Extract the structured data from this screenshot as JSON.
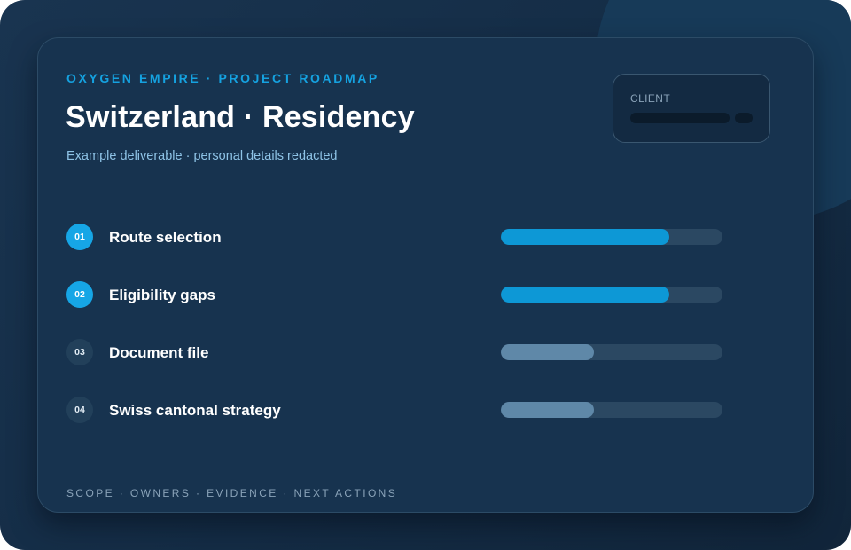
{
  "header": {
    "kicker": "OXYGEN EMPIRE · PROJECT ROADMAP",
    "title": "Switzerland · Residency",
    "subtitle": "Example deliverable · personal details redacted"
  },
  "client": {
    "label": "CLIENT"
  },
  "steps": [
    {
      "number": "01",
      "label": "Route selection",
      "progress": 0.76,
      "status": "active"
    },
    {
      "number": "02",
      "label": "Eligibility gaps",
      "progress": 0.76,
      "status": "active"
    },
    {
      "number": "03",
      "label": "Document file",
      "progress": 0.42,
      "status": "idle"
    },
    {
      "number": "04",
      "label": "Swiss cantonal strategy",
      "progress": 0.42,
      "status": "idle"
    }
  ],
  "footer": {
    "text": "SCOPE · OWNERS · EVIDENCE · NEXT ACTIONS"
  },
  "colors": {
    "accent": "#16a6e6",
    "active_fill": "#0d98d6",
    "idle_fill": "#5f88a8"
  }
}
